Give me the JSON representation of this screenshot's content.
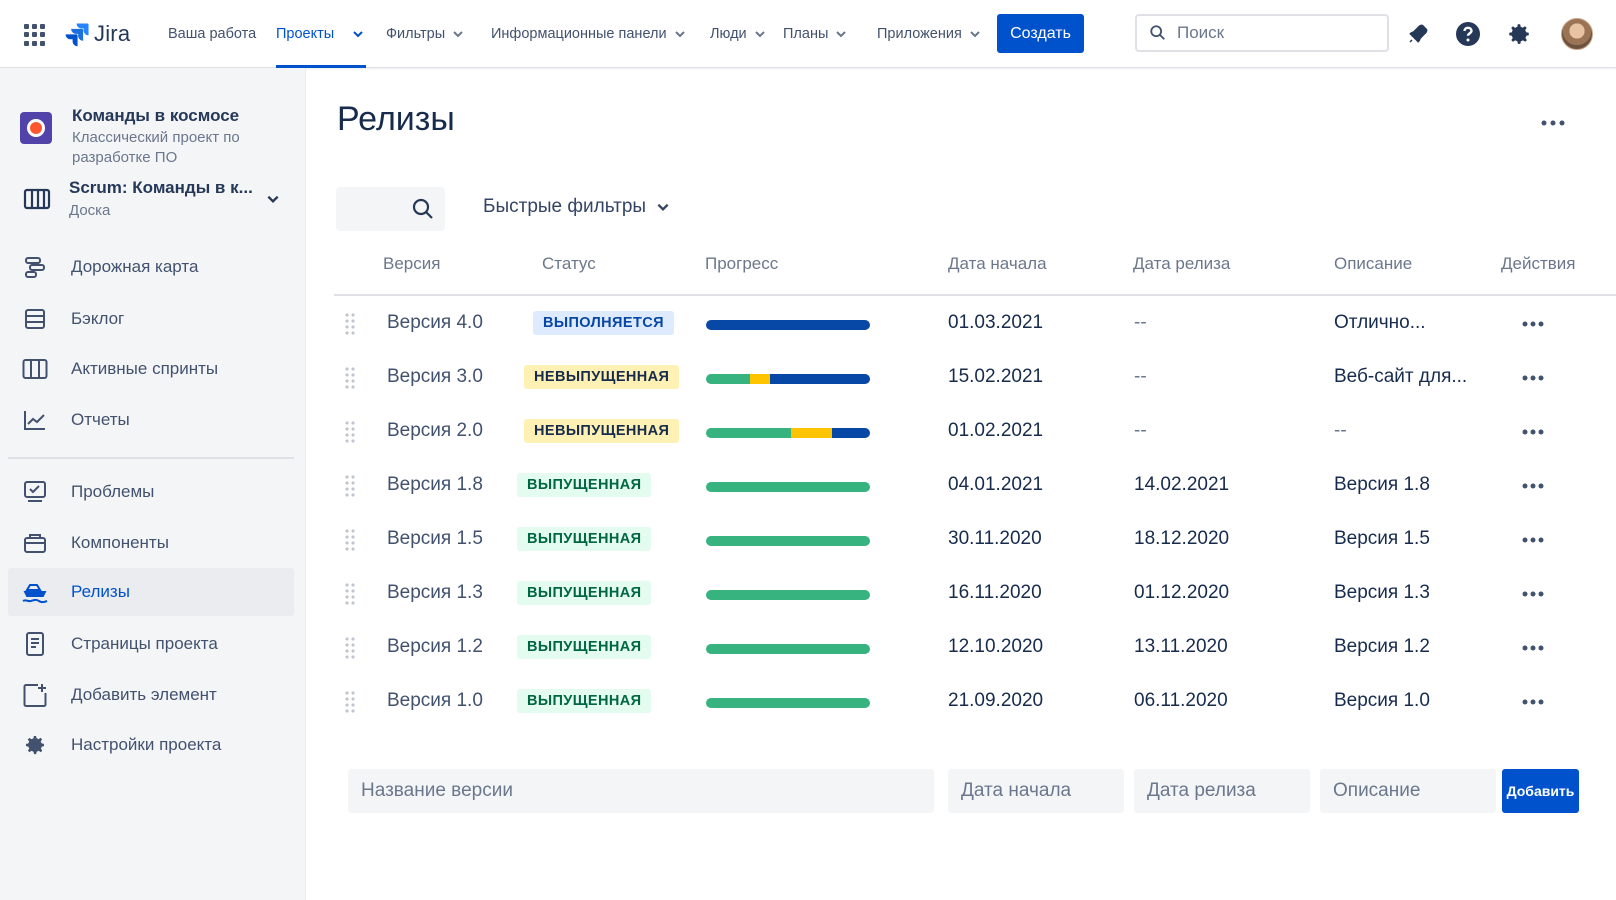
{
  "topnav": {
    "app_name": "Jira",
    "items": [
      {
        "label": "Ваша работа"
      },
      {
        "label": "Проекты"
      },
      {
        "label": "Фильтры"
      },
      {
        "label": "Информационные панели"
      },
      {
        "label": "Люди"
      },
      {
        "label": "Планы"
      },
      {
        "label": "Приложения"
      }
    ],
    "create_label": "Создать",
    "search_placeholder": "Поиск",
    "accent": "#0052cc"
  },
  "sidebar": {
    "project_name": "Команды в космосе",
    "project_type": "Классический проект по разработке ПО",
    "board_name": "Scrum: Команды в к...",
    "board_sub": "Доска",
    "items": [
      {
        "label": "Дорожная карта",
        "icon": "roadmap-icon"
      },
      {
        "label": "Бэклог",
        "icon": "backlog-icon"
      },
      {
        "label": "Активные спринты",
        "icon": "board-columns-icon"
      },
      {
        "label": "Отчеты",
        "icon": "chart-icon"
      },
      {
        "label": "Проблемы",
        "icon": "issues-icon"
      },
      {
        "label": "Компоненты",
        "icon": "components-icon"
      },
      {
        "label": "Релизы",
        "icon": "ship-icon"
      },
      {
        "label": "Страницы проекта",
        "icon": "page-icon"
      },
      {
        "label": "Добавить элемент",
        "icon": "add-item-icon"
      },
      {
        "label": "Настройки проекта",
        "icon": "gear-icon"
      }
    ],
    "selected": "Релизы"
  },
  "main": {
    "title": "Релизы",
    "quick_filters_label": "Быстрые фильтры",
    "columns": {
      "version": "Версия",
      "status": "Статус",
      "progress": "Прогресс",
      "start": "Дата начала",
      "release": "Дата релиза",
      "description": "Описание",
      "actions": "Действия"
    },
    "rows": [
      {
        "version": "Версия 4.0",
        "status": "ВЫПОЛНЯЕТСЯ",
        "status_kind": "progress",
        "progress": {
          "done": 0,
          "in_progress": 0,
          "todo": 1
        },
        "start": "01.03.2021",
        "release": "--",
        "description": "Отлично..."
      },
      {
        "version": "Версия 3.0",
        "status": "НЕВЫПУЩЕННАЯ",
        "status_kind": "unreleased",
        "progress": {
          "done": 0.27,
          "in_progress": 0.12,
          "todo": 0.61
        },
        "start": "15.02.2021",
        "release": "--",
        "description": "Веб-сайт для..."
      },
      {
        "version": "Версия 2.0",
        "status": "НЕВЫПУЩЕННАЯ",
        "status_kind": "unreleased",
        "progress": {
          "done": 0.52,
          "in_progress": 0.25,
          "todo": 0.23
        },
        "start": "01.02.2021",
        "release": "--",
        "description": "--"
      },
      {
        "version": "Версия 1.8",
        "status": "ВЫПУЩЕННАЯ",
        "status_kind": "released",
        "progress": {
          "done": 1,
          "in_progress": 0,
          "todo": 0
        },
        "start": "04.01.2021",
        "release": "14.02.2021",
        "description": "Версия 1.8"
      },
      {
        "version": "Версия 1.5",
        "status": "ВЫПУЩЕННАЯ",
        "status_kind": "released",
        "progress": {
          "done": 1,
          "in_progress": 0,
          "todo": 0
        },
        "start": "30.11.2020",
        "release": "18.12.2020",
        "description": "Версия 1.5"
      },
      {
        "version": "Версия 1.3",
        "status": "ВЫПУЩЕННАЯ",
        "status_kind": "released",
        "progress": {
          "done": 1,
          "in_progress": 0,
          "todo": 0
        },
        "start": "16.11.2020",
        "release": "01.12.2020",
        "description": "Версия 1.3"
      },
      {
        "version": "Версия 1.2",
        "status": "ВЫПУЩЕННАЯ",
        "status_kind": "released",
        "progress": {
          "done": 1,
          "in_progress": 0,
          "todo": 0
        },
        "start": "12.10.2020",
        "release": "13.11.2020",
        "description": "Версия 1.2"
      },
      {
        "version": "Версия 1.0",
        "status": "ВЫПУЩЕННАЯ",
        "status_kind": "released",
        "progress": {
          "done": 1,
          "in_progress": 0,
          "todo": 0
        },
        "start": "21.09.2020",
        "release": "06.11.2020",
        "description": "Версия 1.0"
      }
    ],
    "progress_colors": {
      "done": "#36b37e",
      "in_progress": "#ffc400",
      "todo": "#0747a6"
    },
    "add_form": {
      "name_placeholder": "Название версии",
      "start_placeholder": "Дата начала",
      "release_placeholder": "Дата релиза",
      "description_placeholder": "Описание",
      "add_label": "Добавить"
    }
  }
}
